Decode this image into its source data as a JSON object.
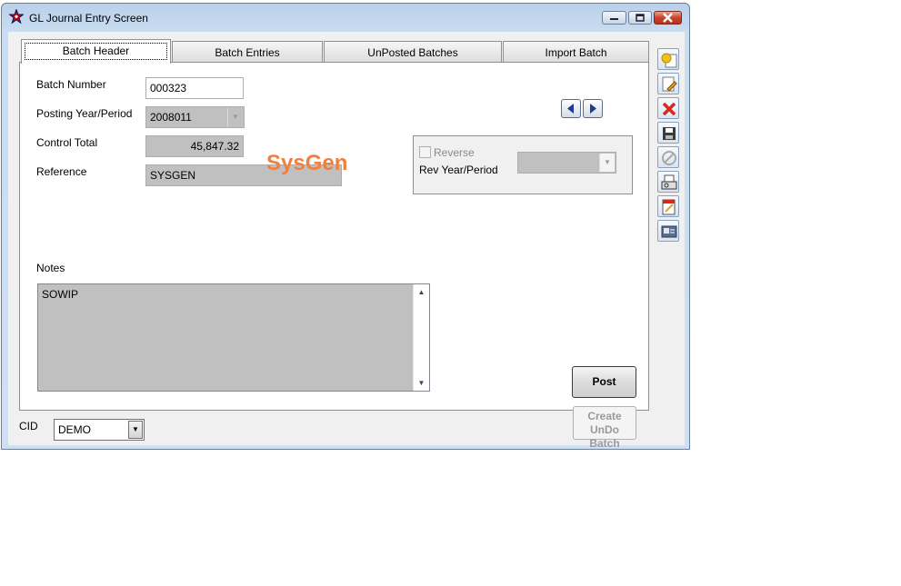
{
  "window": {
    "title": "GL Journal Entry Screen"
  },
  "tabs": [
    {
      "label": "Batch Header"
    },
    {
      "label": "Batch Entries"
    },
    {
      "label": "UnPosted Batches"
    },
    {
      "label": "Import Batch"
    }
  ],
  "header": {
    "batch_number_label": "Batch Number",
    "batch_number": "000323",
    "posting_period_label": "Posting Year/Period",
    "posting_period": "2008011",
    "control_total_label": "Control Total",
    "control_total": "45,847.32",
    "reference_label": "Reference",
    "reference": "SYSGEN",
    "sysgen_tag": "SysGen"
  },
  "reverse": {
    "checkbox_label": "Reverse",
    "checked": false,
    "rev_period_label": "Rev Year/Period",
    "rev_period": ""
  },
  "notes": {
    "label": "Notes",
    "text": "SOWIP"
  },
  "buttons": {
    "post": "Post",
    "undo_line1": "Create",
    "undo_line2": "UnDo Batch"
  },
  "cid": {
    "label": "CID",
    "value": "DEMO"
  },
  "toolbar": [
    "add-note-icon",
    "edit-icon",
    "delete-icon",
    "save-icon",
    "cancel-icon",
    "print-preview-icon",
    "report-icon",
    "id-card-icon"
  ],
  "colors": {
    "sysgen": "#f08040",
    "readonly_field": "#c0c0c0",
    "delete": "#d9291c"
  }
}
